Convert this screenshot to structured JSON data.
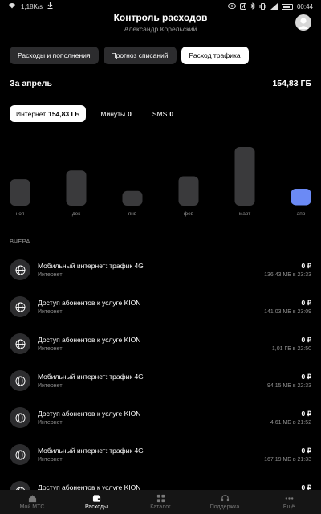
{
  "status": {
    "speed": "1,18K/s",
    "time": "00:44"
  },
  "header": {
    "title": "Контроль расходов",
    "subtitle": "Александр Корельский"
  },
  "tabs": [
    {
      "label": "Расходы и пополнения",
      "active": false
    },
    {
      "label": "Прогноз списаний",
      "active": false
    },
    {
      "label": "Расход трафика",
      "active": true
    }
  ],
  "period": {
    "label": "За апрель",
    "total": "154,83 ГБ"
  },
  "filters": [
    {
      "label": "Интернет",
      "value": "154,83 ГБ",
      "active": true
    },
    {
      "label": "Минуты",
      "value": "0",
      "active": false
    },
    {
      "label": "SMS",
      "value": "0",
      "active": false
    }
  ],
  "chart_data": {
    "type": "bar",
    "categories": [
      "ноя",
      "дек",
      "янв",
      "фев",
      "март",
      "апр"
    ],
    "values": [
      0.45,
      0.6,
      0.25,
      0.5,
      1.0,
      0.28
    ],
    "highlighted": "апр",
    "bar_color": "#3a3a3c",
    "highlight_color": "#6b8af5"
  },
  "section": {
    "label": "ВЧЕРА"
  },
  "items": [
    {
      "name": "Мобильный интернет: трафик 4G",
      "category": "Интернет",
      "amount": "0 ₽",
      "detail": "136,43 МБ в 23:33",
      "icon": "globe-icon"
    },
    {
      "name": "Доступ абонентов к услуге KION",
      "category": "Интернет",
      "amount": "0 ₽",
      "detail": "141,03 МБ в 23:09",
      "icon": "globe-icon"
    },
    {
      "name": "Доступ абонентов к услуге KION",
      "category": "Интернет",
      "amount": "0 ₽",
      "detail": "1,01 ГБ в 22:50",
      "icon": "globe-icon"
    },
    {
      "name": "Мобильный интернет: трафик 4G",
      "category": "Интернет",
      "amount": "0 ₽",
      "detail": "94,15 МБ в 22:33",
      "icon": "globe-icon"
    },
    {
      "name": "Доступ абонентов к услуге KION",
      "category": "Интернет",
      "amount": "0 ₽",
      "detail": "4,61 МБ в 21:52",
      "icon": "globe-icon"
    },
    {
      "name": "Мобильный интернет: трафик 4G",
      "category": "Интернет",
      "amount": "0 ₽",
      "detail": "167,19 МБ в 21:33",
      "icon": "globe-icon"
    },
    {
      "name": "Доступ абонентов к услуге KION",
      "category": "",
      "amount": "0 ₽",
      "detail": "",
      "icon": "globe-icon"
    }
  ],
  "nav": [
    {
      "label": "Мой МТС",
      "icon": "home-icon",
      "active": false
    },
    {
      "label": "Расходы",
      "icon": "wallet-icon",
      "active": true
    },
    {
      "label": "Каталог",
      "icon": "grid-icon",
      "active": false
    },
    {
      "label": "Поддержка",
      "icon": "headset-icon",
      "active": false
    },
    {
      "label": "Ещё",
      "icon": "more-icon",
      "active": false
    }
  ]
}
